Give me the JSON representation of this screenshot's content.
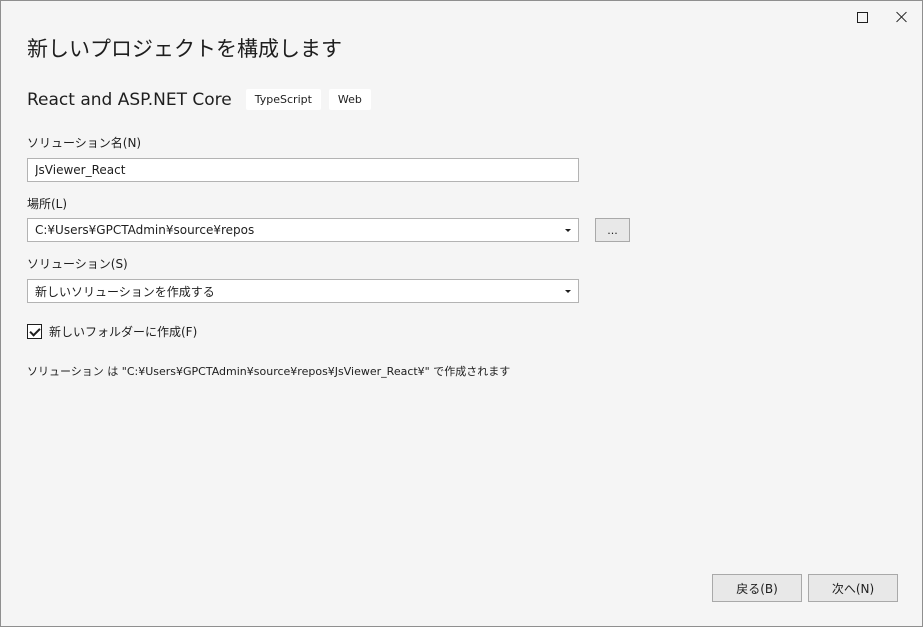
{
  "window": {
    "maximize_icon": "maximize-icon",
    "close_icon": "close-icon"
  },
  "header": {
    "title": "新しいプロジェクトを構成します"
  },
  "template": {
    "name": "React and ASP.NET Core",
    "tags": [
      "TypeScript",
      "Web"
    ]
  },
  "form": {
    "solution_name_label": "ソリューション名(N)",
    "solution_name_value": "JsViewer_React",
    "location_label": "場所(L)",
    "location_value": "C:¥Users¥GPCTAdmin¥source¥repos",
    "browse_label": "...",
    "solution_label": "ソリューション(S)",
    "solution_value": "新しいソリューションを作成する",
    "new_folder_label": "新しいフォルダーに作成(F)",
    "new_folder_checked": true,
    "summary": "ソリューション は \"C:¥Users¥GPCTAdmin¥source¥repos¥JsViewer_React¥\" で作成されます"
  },
  "footer": {
    "back_label": "戻る(B)",
    "next_label": "次へ(N)"
  }
}
